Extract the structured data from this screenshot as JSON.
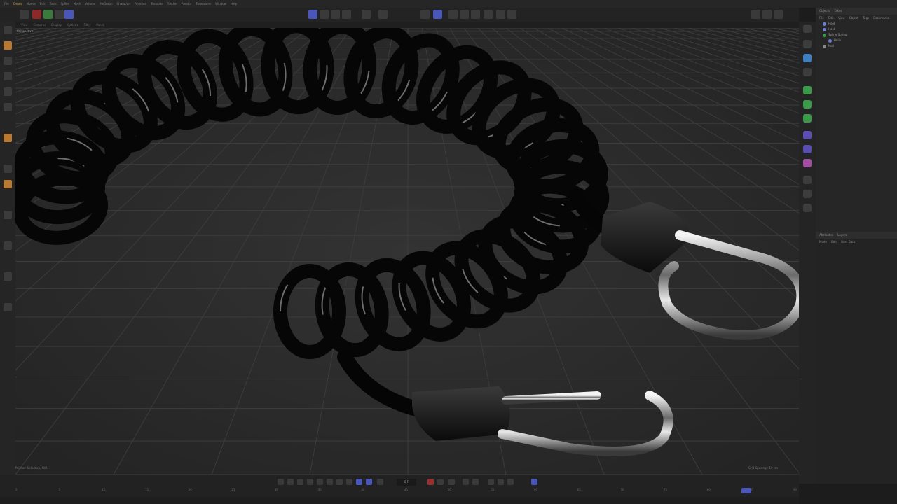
{
  "menubar": {
    "items": [
      "File",
      "Create",
      "Modes",
      "Edit",
      "Tools",
      "Spline",
      "Mesh",
      "Volume",
      "MoGraph",
      "Character",
      "Animate",
      "Simulate",
      "Tracker",
      "Render",
      "Extensions",
      "Window",
      "Help"
    ],
    "active_index": 1
  },
  "viewport": {
    "menu": [
      "View",
      "Cameras",
      "Display",
      "Options",
      "Filter",
      "Panel"
    ],
    "label": "Perspective",
    "status_text": "Pointer: Selection, Ctrl-...",
    "grid_spacing": "Grid Spacing : 10 cm"
  },
  "objects_panel": {
    "tabs": [
      "Objects",
      "Takes"
    ],
    "menu": [
      "File",
      "Edit",
      "View",
      "Object",
      "Tags",
      "Bookmarks"
    ],
    "rows": [
      "Hook",
      "Hook",
      "Spline Spring",
      "Helix",
      "Null"
    ]
  },
  "attributes_panel": {
    "tabs": [
      "Attributes",
      "Layers"
    ],
    "menu": [
      "Mode",
      "Edit",
      "User Data"
    ]
  },
  "left_panel": {
    "label": "PM Modifiers"
  },
  "timeline": {
    "frame": "0 F",
    "ticks": [
      "0",
      "5",
      "10",
      "15",
      "20",
      "25",
      "30",
      "35",
      "40",
      "45",
      "50",
      "55",
      "60",
      "65",
      "70",
      "75",
      "80",
      "85",
      "90"
    ]
  },
  "colors": {
    "accent": "#4b57b8",
    "highlight": "#c9a94a"
  }
}
